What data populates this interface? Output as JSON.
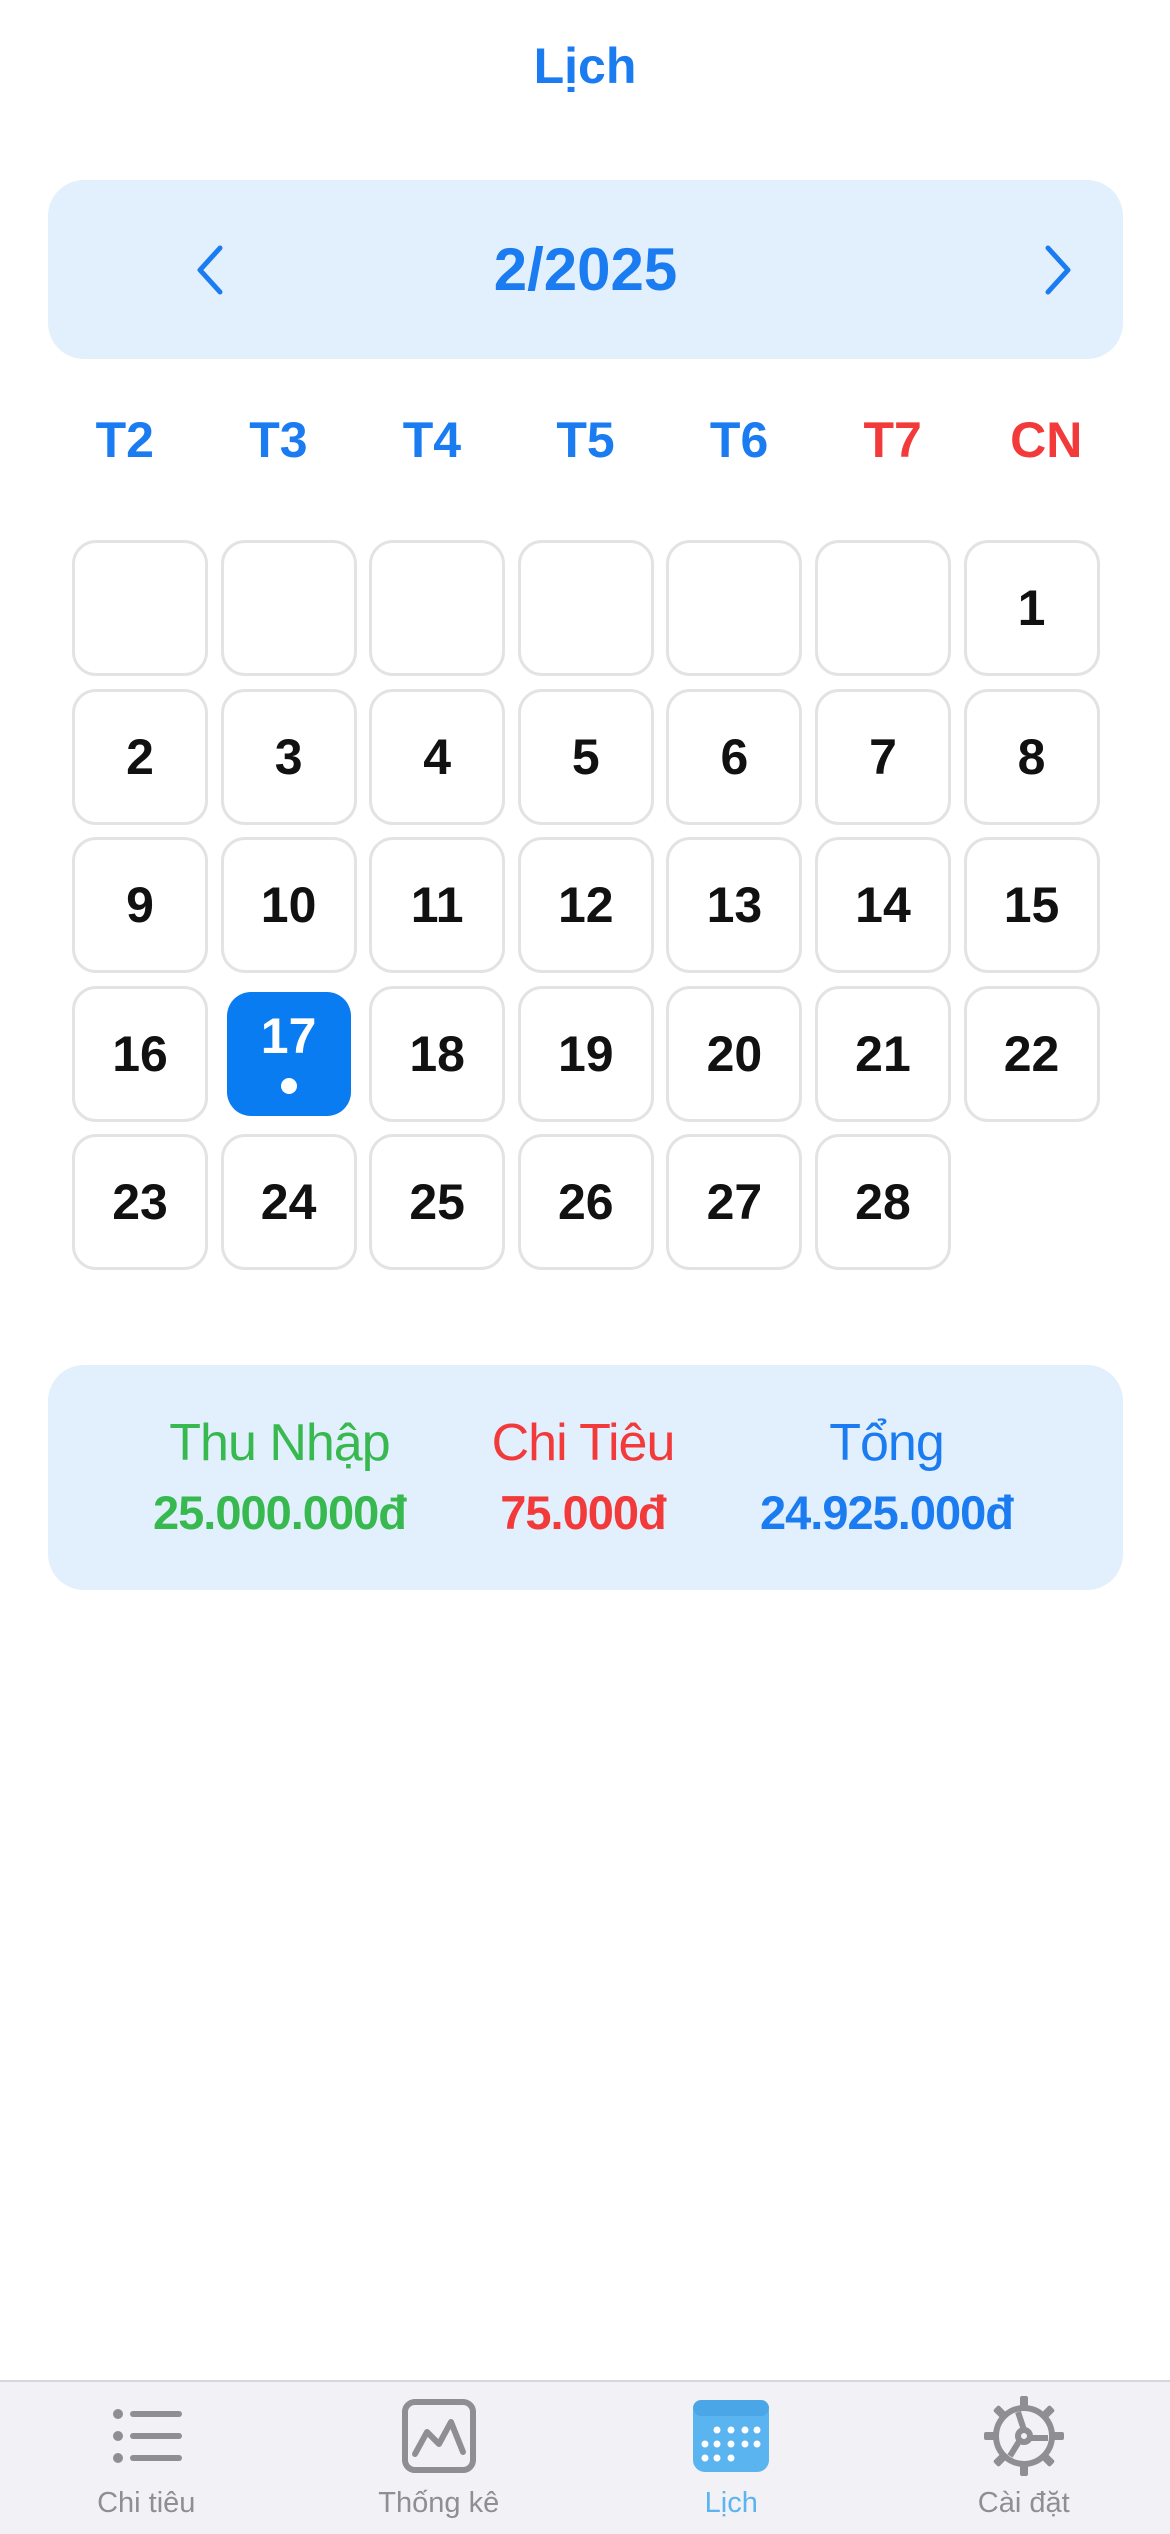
{
  "header": {
    "title": "Lịch"
  },
  "month_nav": {
    "label": "2/2025"
  },
  "weekdays": [
    {
      "label": "T2",
      "color": "#1a7cf0"
    },
    {
      "label": "T3",
      "color": "#1a7cf0"
    },
    {
      "label": "T4",
      "color": "#1a7cf0"
    },
    {
      "label": "T5",
      "color": "#1a7cf0"
    },
    {
      "label": "T6",
      "color": "#1a7cf0"
    },
    {
      "label": "T7",
      "color": "#f23a3a"
    },
    {
      "label": "CN",
      "color": "#f23a3a"
    }
  ],
  "calendar": {
    "leading_empty": 6,
    "days": [
      "1",
      "2",
      "3",
      "4",
      "5",
      "6",
      "7",
      "8",
      "9",
      "10",
      "11",
      "12",
      "13",
      "14",
      "15",
      "16",
      "17",
      "18",
      "19",
      "20",
      "21",
      "22",
      "23",
      "24",
      "25",
      "26",
      "27",
      "28"
    ],
    "selected_day": "17",
    "event_days": [
      "17"
    ]
  },
  "summary": {
    "income_label": "Thu Nhập",
    "income_value": "25.000.000đ",
    "expense_label": "Chi Tiêu",
    "expense_value": "75.000đ",
    "total_label": "Tổng",
    "total_value": "24.925.000đ"
  },
  "colors": {
    "accent": "#1a7cf0",
    "income": "#37b94f",
    "expense": "#f23a3a",
    "selected_bg": "#0a7cf2",
    "tab_active": "#5ab4f0",
    "tab_inactive": "#8e8e93"
  },
  "tabbar": {
    "items": [
      {
        "label": "Chi tiêu",
        "icon": "list-icon",
        "active": false
      },
      {
        "label": "Thống kê",
        "icon": "chart-icon",
        "active": false
      },
      {
        "label": "Lịch",
        "icon": "calendar-icon",
        "active": true
      },
      {
        "label": "Cài đặt",
        "icon": "gear-icon",
        "active": false
      }
    ]
  }
}
